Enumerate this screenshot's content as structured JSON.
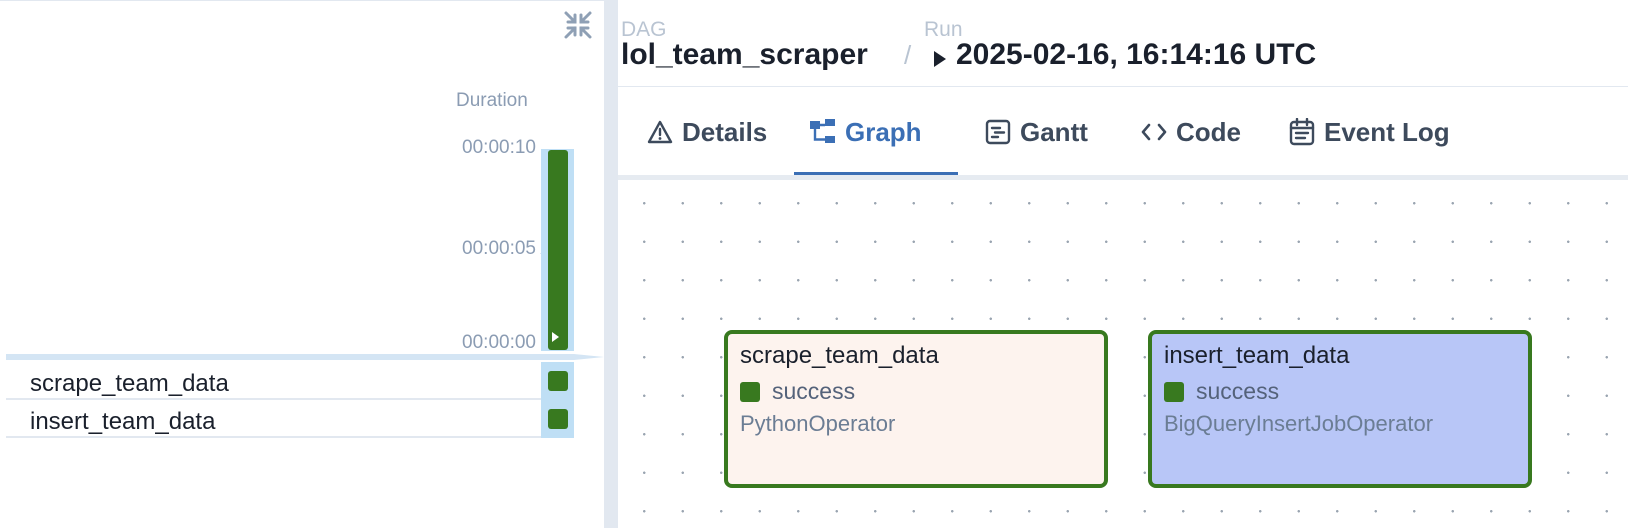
{
  "grid": {
    "duration_label": "Duration",
    "ticks": [
      "00:00:10",
      "00:00:05",
      "00:00:00"
    ],
    "run_bar": {
      "state": "success",
      "color": "#38791f",
      "fraction_of_max": 1.0
    },
    "tasks": [
      {
        "name": "scrape_team_data",
        "state": "success"
      },
      {
        "name": "insert_team_data",
        "state": "success"
      }
    ]
  },
  "header": {
    "dag_label": "DAG",
    "dag_name": "lol_team_scraper",
    "separator": "/",
    "run_label": "Run",
    "run_value": "2025-02-16, 16:14:16 UTC"
  },
  "tabs": [
    {
      "label": "Details",
      "icon": "warning-triangle-icon"
    },
    {
      "label": "Graph",
      "icon": "graph-icon",
      "active": true
    },
    {
      "label": "Gantt",
      "icon": "gantt-icon"
    },
    {
      "label": "Code",
      "icon": "code-icon"
    },
    {
      "label": "Event Log",
      "icon": "calendar-log-icon"
    }
  ],
  "graph": {
    "nodes": [
      {
        "id": "scrape_team_data",
        "state": "success",
        "operator": "PythonOperator",
        "bg": "#fdf3ee"
      },
      {
        "id": "insert_team_data",
        "state": "success",
        "operator": "BigQueryInsertJobOperator",
        "bg": "#b8c6f7"
      }
    ],
    "edges": [
      {
        "from": "scrape_team_data",
        "to": "insert_team_data"
      }
    ]
  },
  "colors": {
    "success": "#38791f",
    "accent": "#3b6fb5",
    "grid_highlight": "#bfdff5"
  }
}
